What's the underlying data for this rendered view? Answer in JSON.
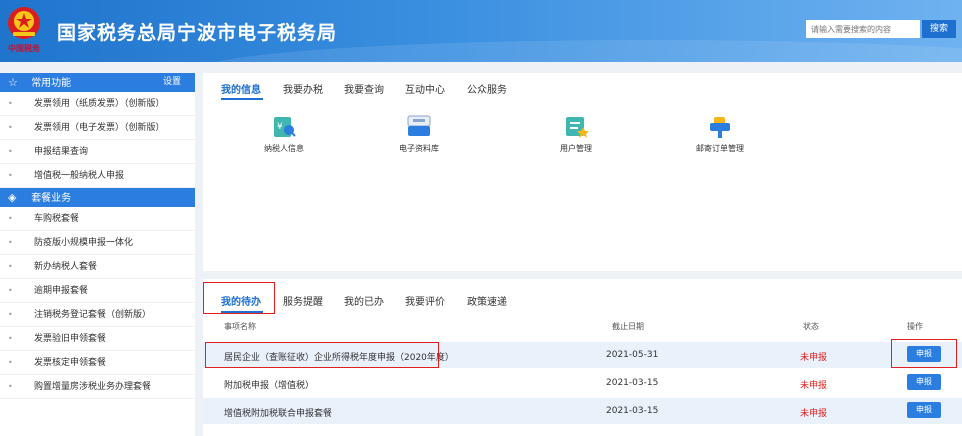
{
  "header": {
    "emblem_text": "中国税务",
    "title": "国家税务总局宁波市电子税务局",
    "search_placeholder": "请输入需要搜索的内容",
    "search_button": "搜索"
  },
  "sidebar": {
    "common_title": "常用功能",
    "settings_label": "设置",
    "common_items": [
      "发票领用（纸质发票）（创新版）",
      "发票领用（电子发票）（创新版）",
      "申报结果查询",
      "增值税一般纳税人申报"
    ],
    "package_title": "套餐业务",
    "package_items": [
      "车购税套餐",
      "防疫版小规模申报一体化",
      "新办纳税人套餐",
      "逾期申报套餐",
      "注销税务登记套餐（创新版）",
      "发票验旧申领套餐",
      "发票核定申领套餐",
      "购置增量房涉税业务办理套餐"
    ]
  },
  "info_panel": {
    "tabs": [
      "我的信息",
      "我要办税",
      "我要查询",
      "互动中心",
      "公众服务"
    ],
    "icons": [
      {
        "label": "纳税人信息",
        "icon": "taxpayer-info-icon"
      },
      {
        "label": "电子资料库",
        "icon": "e-library-icon"
      },
      {
        "label": "用户管理",
        "icon": "user-management-icon"
      },
      {
        "label": "邮寄订单管理",
        "icon": "mail-order-icon"
      }
    ]
  },
  "todo_panel": {
    "tabs": [
      "我的待办",
      "服务提醒",
      "我的已办",
      "我要评价",
      "政策速递"
    ],
    "columns": [
      "事项名称",
      "截止日期",
      "状态",
      "操作"
    ],
    "rows": [
      {
        "name": "居民企业（查账征收）企业所得税年度申报（2020年度）",
        "deadline": "2021-05-31",
        "status": "未申报",
        "action": "申报"
      },
      {
        "name": "附加税申报（增值税）",
        "deadline": "2021-03-15",
        "status": "未申报",
        "action": "申报"
      },
      {
        "name": "增值税附加税联合申报套餐",
        "deadline": "2021-03-15",
        "status": "未申报",
        "action": "申报"
      }
    ]
  },
  "colors": {
    "header_blue": "#1f74cc",
    "accent_blue": "#2b7de0",
    "status_red": "#e02020",
    "highlight_red": "#e02020"
  }
}
